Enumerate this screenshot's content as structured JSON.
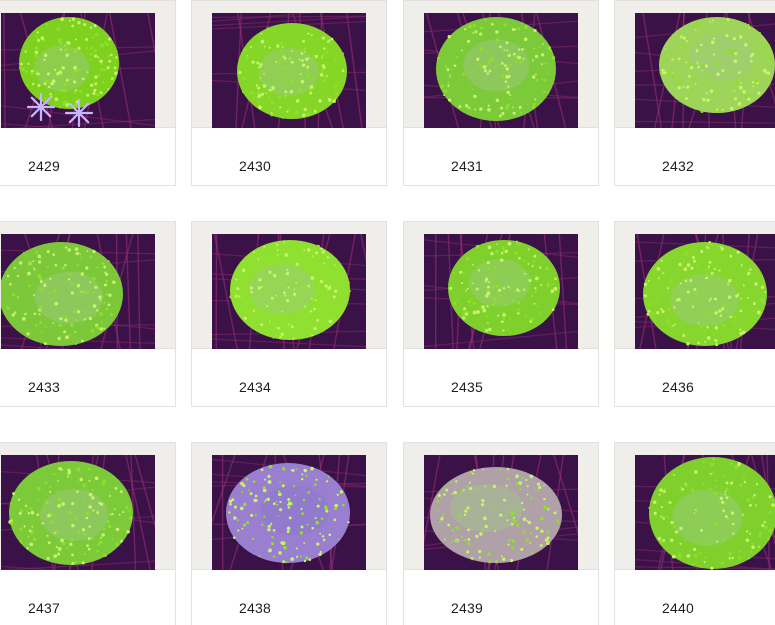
{
  "gallery": {
    "items": [
      {
        "number": "2429",
        "image": "green-leather-coral-with-purple-star-polyps"
      },
      {
        "number": "2430",
        "image": "green-toadstool-coral"
      },
      {
        "number": "2431",
        "image": "green-leather-coral"
      },
      {
        "number": "2432",
        "image": "green-leather-coral"
      },
      {
        "number": "2433",
        "image": "green-leather-coral"
      },
      {
        "number": "2434",
        "image": "green-toadstool-coral"
      },
      {
        "number": "2435",
        "image": "green-leather-coral"
      },
      {
        "number": "2436",
        "image": "green-leather-coral"
      },
      {
        "number": "2437",
        "image": "green-leather-coral"
      },
      {
        "number": "2438",
        "image": "green-leather-coral-purple-center"
      },
      {
        "number": "2439",
        "image": "pink-green-finger-leather-coral"
      },
      {
        "number": "2440",
        "image": "green-leather-coral"
      }
    ]
  },
  "colors": {
    "coral_green": "#8ee02a",
    "coral_highlight": "#c6f56a",
    "background_purple": "#3b1248",
    "frame": "#efeeeb"
  }
}
